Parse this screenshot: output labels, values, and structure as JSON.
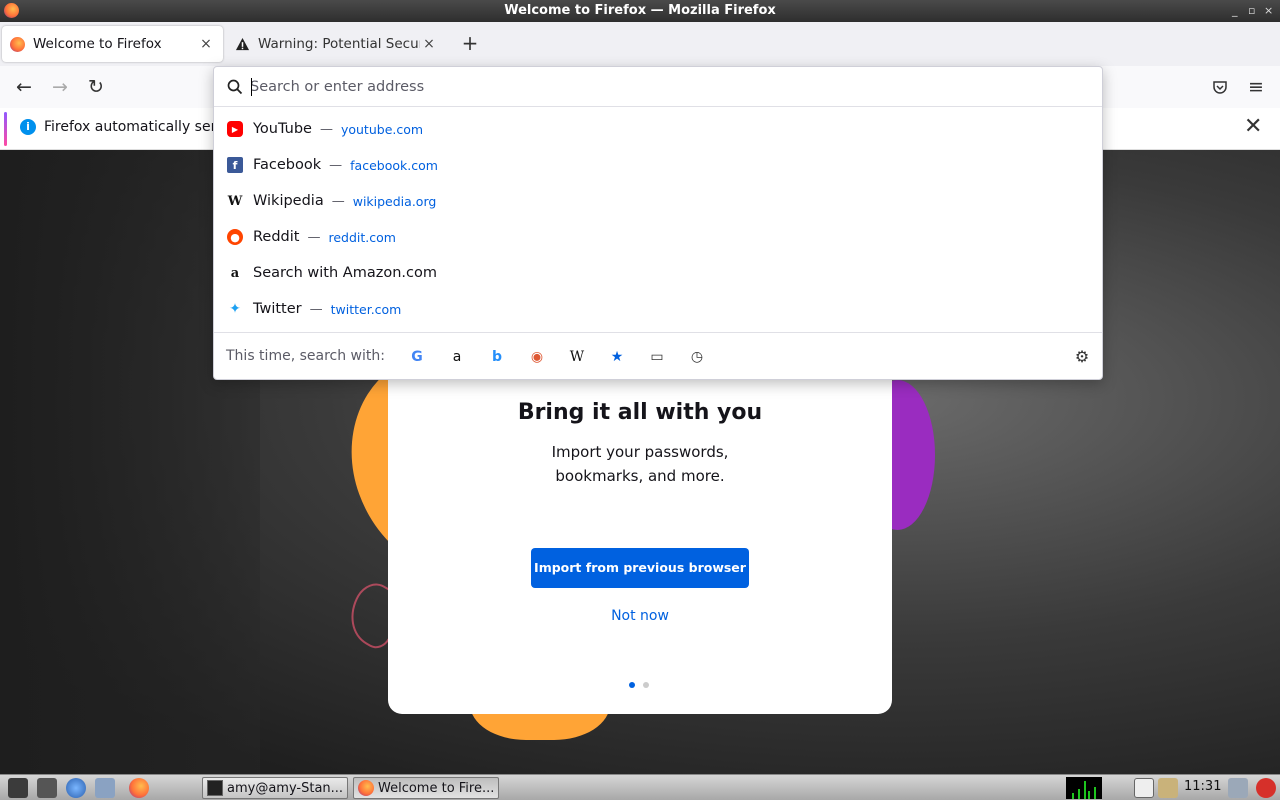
{
  "window": {
    "title": "Welcome to Firefox — Mozilla Firefox",
    "controls": [
      "_",
      "▫",
      "×"
    ]
  },
  "tabs": [
    {
      "label": "Welcome to Firefox",
      "close": "×",
      "active": true,
      "icon": "firefox-icon"
    },
    {
      "label": "Warning: Potential Security Risk Ahead",
      "close": "×",
      "active": false,
      "icon": "warning-icon"
    }
  ],
  "new_tab": "+",
  "toolbar": {
    "back": "←",
    "forward": "→",
    "reload": "↻",
    "pocket": "pocket-icon",
    "menu": "≡"
  },
  "notification": {
    "icon": "i",
    "message": "Firefox automatically sends some data to Mozilla so that we can improve your experience.",
    "close": "✕"
  },
  "urlbar": {
    "placeholder": "Search or enter address",
    "value": "",
    "separator": "—",
    "results": [
      {
        "title": "YouTube",
        "url": "youtube.com",
        "icon": "youtube-icon",
        "color": "#ff0000",
        "glyph": "▶"
      },
      {
        "title": "Facebook",
        "url": "facebook.com",
        "icon": "facebook-icon",
        "color": "#3b5998",
        "glyph": "f"
      },
      {
        "title": "Wikipedia",
        "url": "wikipedia.org",
        "icon": "wikipedia-icon",
        "color": "#ffffff",
        "glyph": "W"
      },
      {
        "title": "Reddit",
        "url": "reddit.com",
        "icon": "reddit-icon",
        "color": "#ff4500",
        "glyph": "●"
      },
      {
        "title": "Search with Amazon.com",
        "url": "",
        "icon": "amazon-icon",
        "color": "#ffffff",
        "glyph": "a"
      },
      {
        "title": "Twitter",
        "url": "twitter.com",
        "icon": "twitter-icon",
        "color": "#1da1f2",
        "glyph": "✦"
      }
    ],
    "oneoff_label": "This time, search with:",
    "engines": [
      {
        "name": "google-icon",
        "glyph": "G",
        "color": "#4285f4"
      },
      {
        "name": "amazon-icon",
        "glyph": "a",
        "color": "#111111"
      },
      {
        "name": "bing-icon",
        "glyph": "b",
        "color": "#258ffa"
      },
      {
        "name": "duckduckgo-icon",
        "glyph": "◉",
        "color": "#de5833"
      },
      {
        "name": "wikipedia-icon",
        "glyph": "W",
        "color": "#111111"
      },
      {
        "name": "bookmarks-icon",
        "glyph": "★",
        "color": "#0060df"
      },
      {
        "name": "tabs-icon",
        "glyph": "▭",
        "color": "#333333"
      },
      {
        "name": "history-icon",
        "glyph": "◷",
        "color": "#333333"
      }
    ],
    "settings_icon": "⚙"
  },
  "onboarding": {
    "heading": "Bring it all with you",
    "subtext_line1": "Import your passwords,",
    "subtext_line2": "bookmarks, and more.",
    "primary_button": "Import from previous browser",
    "secondary_link": "Not now",
    "step": 1,
    "steps_total": 2
  },
  "taskbar": {
    "tasks": [
      {
        "label": "amy@amy-Stan...",
        "icon": "terminal-icon"
      },
      {
        "label": "Welcome to Fire...",
        "icon": "firefox-icon"
      }
    ],
    "clock": "11:31"
  }
}
